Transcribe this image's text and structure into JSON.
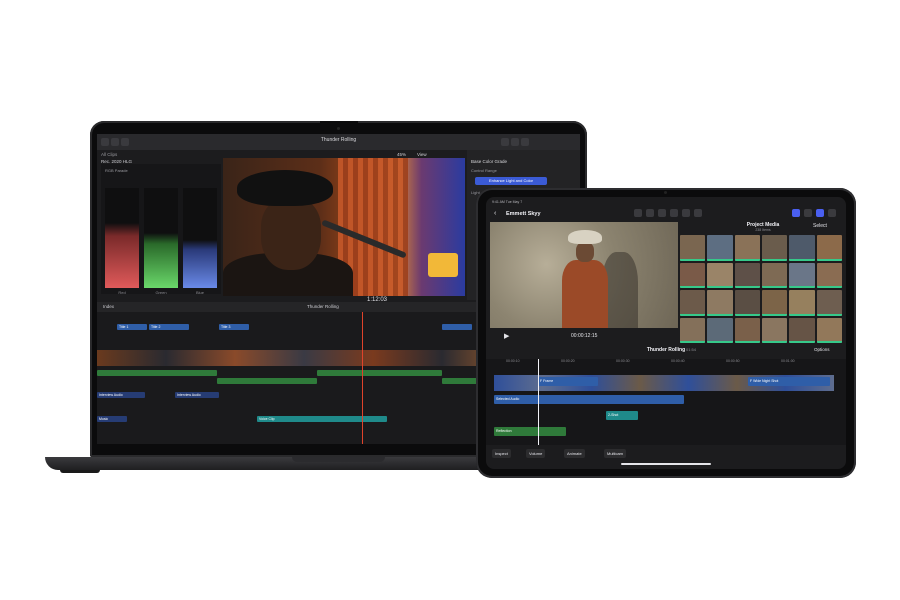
{
  "macbook": {
    "app_title": "Thunder Rolling",
    "library_label": "All Clips",
    "color_space_label": "Rec. 2020 HLG",
    "scope_title": "RGB Parade",
    "scope_labels": [
      "Red",
      "Green",
      "Blue"
    ],
    "zoom_label": "45%",
    "view_label": "View",
    "timecode": "1:12:03",
    "inspector": {
      "header": "Base Color Grade",
      "button": "Enhance Light and Color",
      "rows": [
        "Control Range",
        "Light"
      ]
    },
    "timeline": {
      "index_label": "Index",
      "title": "Thunder Rolling",
      "clips": [
        "Title 1",
        "Title 2",
        "Title 3",
        "Interview Audio",
        "Interview Audio",
        "Music",
        "Voice Clip"
      ]
    }
  },
  "ipad": {
    "status_time": "9:41 AM",
    "status_date": "Tue May 7",
    "project_title": "Emmett Skyy",
    "timecode": "00:00:12:15",
    "media": {
      "title": "Project Media",
      "subtitle": "238 Items",
      "select_label": "Select"
    },
    "timeline": {
      "title": "Thunder Rolling",
      "duration": "01:54",
      "options_label": "Options",
      "ruler": [
        "00:00:10",
        "00:00:20",
        "00:00:30",
        "00:00:40",
        "00:00:50",
        "00:01:00"
      ],
      "clips": [
        "Selected Audio",
        "Reflection",
        "2-Shot",
        "F Frame",
        "F Wide Night Shot"
      ]
    },
    "toolbar": {
      "inspect": "Inspect",
      "volume": "Volume",
      "animate": "Animate",
      "multicam": "Multicam"
    }
  }
}
